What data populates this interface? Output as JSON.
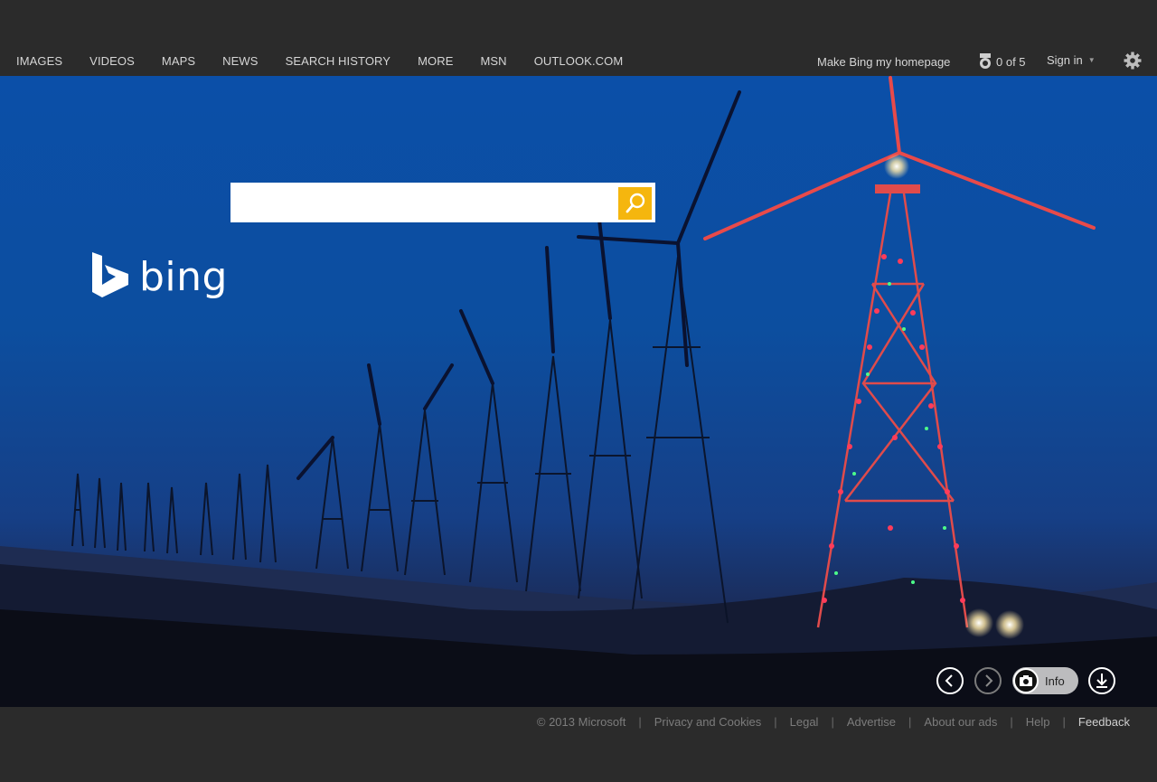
{
  "nav": {
    "items": [
      "IMAGES",
      "VIDEOS",
      "MAPS",
      "NEWS",
      "SEARCH HISTORY",
      "MORE",
      "MSN",
      "OUTLOOK.COM"
    ]
  },
  "header": {
    "homepage_label": "Make Bing my homepage",
    "rewards_count": "0 of 5",
    "signin_label": "Sign in"
  },
  "logo": {
    "wordmark": "bing"
  },
  "search": {
    "value": "",
    "placeholder": ""
  },
  "controls": {
    "info_label": "Info"
  },
  "footer": {
    "copyright": "© 2013 Microsoft",
    "links": [
      "Privacy and Cookies",
      "Legal",
      "Advertise",
      "About our ads",
      "Help"
    ],
    "feedback": "Feedback"
  },
  "colors": {
    "bar_bg": "#2b2b2b",
    "sky": "#0c4e9f",
    "search_button": "#f5b60e",
    "nav_text": "#d6d6d6"
  },
  "icons": [
    "bing-logo-icon",
    "search-icon",
    "medal-icon",
    "gear-icon",
    "chevron-left-icon",
    "chevron-right-icon",
    "camera-icon",
    "download-icon"
  ]
}
